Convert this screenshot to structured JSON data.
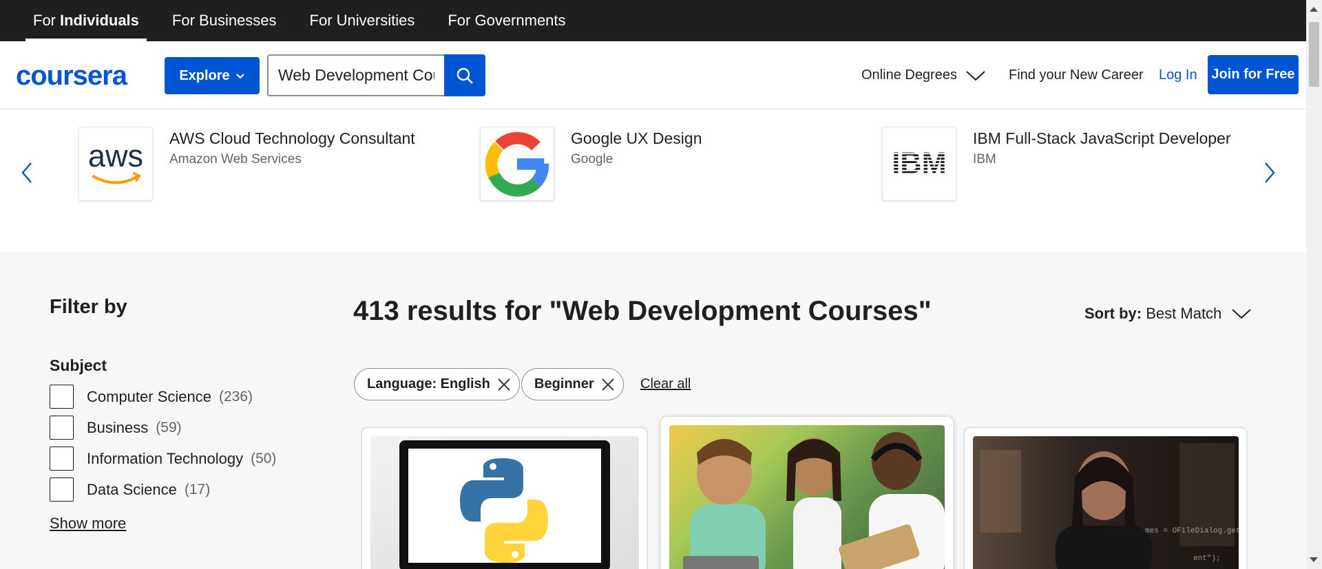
{
  "audience_tabs": [
    {
      "label": "For",
      "bold": "Individuals",
      "active": true
    },
    {
      "label": "For Businesses"
    },
    {
      "label": "For Universities"
    },
    {
      "label": "For Governments"
    }
  ],
  "header": {
    "logo": "coursera",
    "explore_label": "Explore",
    "search_value": "Web Development Courses",
    "online_degrees": "Online Degrees",
    "find_career": "Find your New Career",
    "login": "Log In",
    "join": "Join for Free"
  },
  "carousel": {
    "items": [
      {
        "title": "AWS Cloud Technology Consultant",
        "provider": "Amazon Web Services",
        "logo": "aws-logo"
      },
      {
        "title": "Google UX Design",
        "provider": "Google",
        "logo": "google-logo"
      },
      {
        "title": "IBM Full-Stack JavaScript Developer",
        "provider": "IBM",
        "logo": "ibm-logo"
      }
    ]
  },
  "filters": {
    "title": "Filter by",
    "subject_heading": "Subject",
    "options": [
      {
        "label": "Computer Science",
        "count": "(236)"
      },
      {
        "label": "Business",
        "count": "(59)"
      },
      {
        "label": "Information Technology",
        "count": "(50)"
      },
      {
        "label": "Data Science",
        "count": "(17)"
      }
    ],
    "show_more": "Show more"
  },
  "results": {
    "title": "413 results for \"Web Development Courses\"",
    "sort_label": "Sort by:",
    "sort_value": "Best Match",
    "chips": [
      "Language: English",
      "Beginner"
    ],
    "clear_all": "Clear all"
  },
  "colors": {
    "brand": "#0056d2",
    "topbar": "#1f1f1f"
  }
}
